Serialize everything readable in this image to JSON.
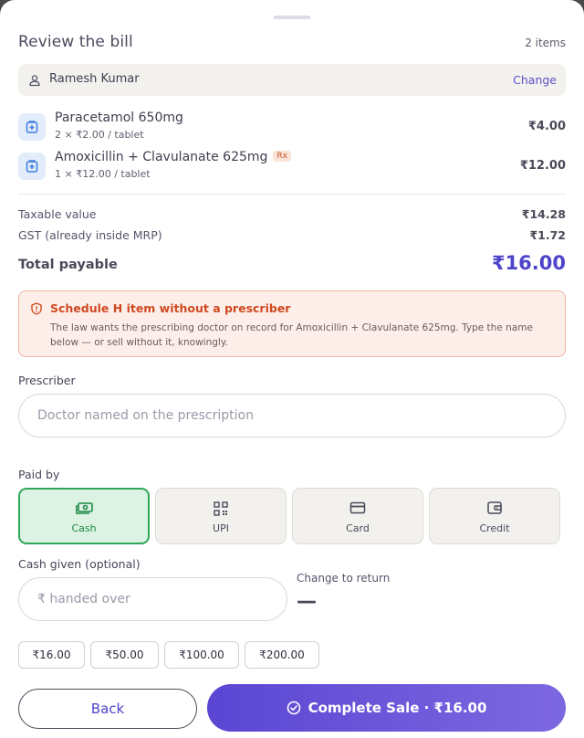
{
  "header": {
    "title": "Review the bill",
    "item_count": "2 items"
  },
  "customer": {
    "name": "Ramesh Kumar",
    "change_label": "Change"
  },
  "items": [
    {
      "name": "Paracetamol 650mg",
      "detail": "2 × ₹2.00 / tablet",
      "amount": "₹4.00",
      "badge": ""
    },
    {
      "name": "Amoxicillin + Clavulanate 625mg",
      "detail": "1 × ₹12.00 / tablet",
      "amount": "₹12.00",
      "badge": "Rx"
    }
  ],
  "summary": {
    "taxable_label": "Taxable value",
    "taxable_value": "₹14.28",
    "gst_label": "GST (already inside MRP)",
    "gst_value": "₹1.72",
    "total_label": "Total payable",
    "total_value": "₹16.00"
  },
  "alert": {
    "title": "Schedule H item without a prescriber",
    "body": "The law wants the prescribing doctor on record for Amoxicillin + Clavulanate 625mg. Type the name below — or sell without it, knowingly."
  },
  "prescriber": {
    "label": "Prescriber",
    "placeholder": "Doctor named on the prescription",
    "value": ""
  },
  "payment": {
    "label": "Paid by",
    "options": [
      {
        "label": "Cash",
        "icon": "cash-icon",
        "selected": true
      },
      {
        "label": "UPI",
        "icon": "qr-code-icon",
        "selected": false
      },
      {
        "label": "Card",
        "icon": "card-icon",
        "selected": false
      },
      {
        "label": "Credit",
        "icon": "wallet-icon",
        "selected": false
      }
    ]
  },
  "cash": {
    "label": "Cash given (optional)",
    "placeholder": "₹ handed over",
    "change_label": "Change to return",
    "change_value": "—"
  },
  "quick_amounts": [
    "₹16.00",
    "₹50.00",
    "₹100.00",
    "₹200.00"
  ],
  "footer": {
    "back_label": "Back",
    "complete_label": "Complete Sale · ₹16.00"
  },
  "colors": {
    "accent": "#5a46d3",
    "success": "#2fa85a",
    "warning": "#cf4a20"
  }
}
